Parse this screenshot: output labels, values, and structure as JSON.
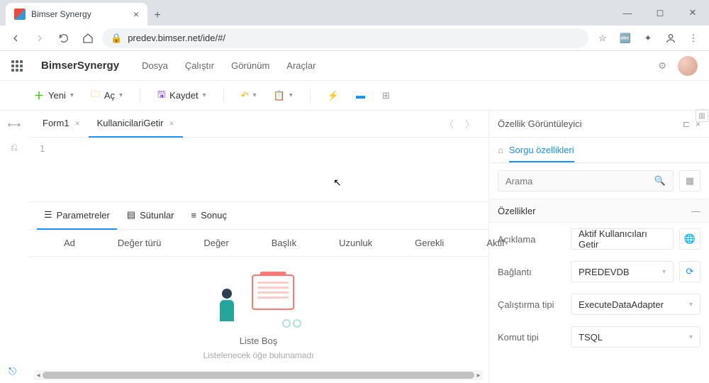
{
  "browser": {
    "tab_title": "Bimser Synergy",
    "url": "predev.bimser.net/ide/#/"
  },
  "app": {
    "brand": "BimserSynergy",
    "menus": [
      "Dosya",
      "Çalıştır",
      "Görünüm",
      "Araçlar"
    ]
  },
  "toolbar": {
    "new_label": "Yeni",
    "open_label": "Aç",
    "save_label": "Kaydet"
  },
  "editor": {
    "tabs": [
      {
        "label": "Form1",
        "active": false
      },
      {
        "label": "KullanicilariGetir",
        "active": true
      }
    ],
    "line_number": "1"
  },
  "bottom_tabs": {
    "parameters": "Parametreler",
    "columns": "Sütunlar",
    "result": "Sonuç"
  },
  "grid": {
    "headers": [
      "Ad",
      "Değer türü",
      "Değer",
      "Başlık",
      "Uzunluk",
      "Gerekli",
      "Aktif"
    ],
    "empty_title": "Liste Boş",
    "empty_sub": "Listelenecek öğe bulunamadı"
  },
  "props": {
    "title": "Özellik Görüntüleyici",
    "tab": "Sorgu özellikleri",
    "search_placeholder": "Arama",
    "section": "Özellikler",
    "rows": {
      "desc_label": "Açıklama",
      "desc_value": "Aktif Kullanıcıları Getir",
      "conn_label": "Bağlantı",
      "conn_value": "PREDEVDB",
      "run_label": "Çalıştırma tipi",
      "run_value": "ExecuteDataAdapter",
      "cmd_label": "Komut tipi",
      "cmd_value": "TSQL"
    }
  }
}
